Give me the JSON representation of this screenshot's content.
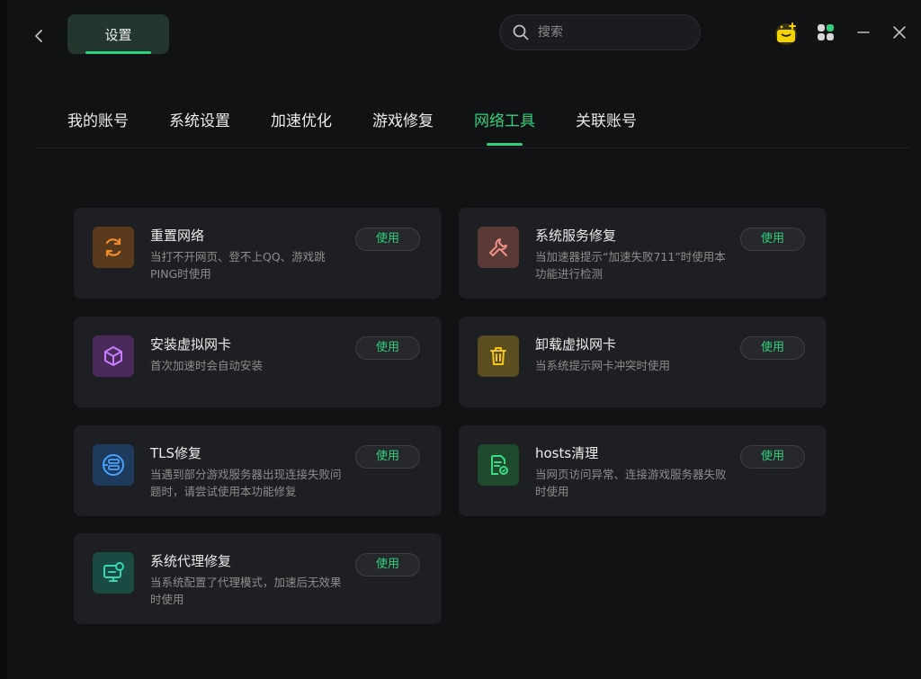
{
  "header": {
    "title": "设置",
    "back_icon": "chevron-left-icon"
  },
  "search": {
    "placeholder": "搜索"
  },
  "toolbar": {
    "gift_icon": "gift-box-icon",
    "apps_icon": "apps-grid-icon",
    "minimize_icon": "minimize-icon",
    "close_icon": "close-icon",
    "gift_color": "#f4d200"
  },
  "tabs": [
    {
      "label": "我的账号"
    },
    {
      "label": "系统设置"
    },
    {
      "label": "加速优化"
    },
    {
      "label": "游戏修复"
    },
    {
      "label": "网络工具",
      "active": true
    },
    {
      "label": "关联账号"
    }
  ],
  "accent": "#2fd17c",
  "tools": [
    {
      "name": "重置网络",
      "desc": "当打不开网页、登不上QQ、游戏跳PING时使用",
      "button": "使用",
      "icon": "refresh-icon",
      "icon_bg": "#5a3a1c",
      "icon_color": "#f08a2c"
    },
    {
      "name": "系统服务修复",
      "desc": "当加速器提示“加速失败711”时使用本功能进行检测",
      "button": "使用",
      "icon": "wrench-icon",
      "icon_bg": "#5a3a36",
      "icon_color": "#f08f86"
    },
    {
      "name": "安装虚拟网卡",
      "desc": "首次加速时会自动安装",
      "button": "使用",
      "icon": "cube-icon",
      "icon_bg": "#4a2a5a",
      "icon_color": "#c77dff"
    },
    {
      "name": "卸载虚拟网卡",
      "desc": "当系统提示网卡冲突时使用",
      "button": "使用",
      "icon": "trash-icon",
      "icon_bg": "#5a4d1f",
      "icon_color": "#f5c518"
    },
    {
      "name": "TLS修复",
      "desc": "当遇到部分游戏服务器出现连接失败问题时，请尝试使用本功能修复",
      "button": "使用",
      "icon": "tls-server-icon",
      "icon_bg": "#1e3a5c",
      "icon_color": "#4aa3ff"
    },
    {
      "name": "hosts清理",
      "desc": "当网页访问异常、连接游戏服务器失败时使用",
      "button": "使用",
      "icon": "file-clean-icon",
      "icon_bg": "#1f4a2e",
      "icon_color": "#3ddc84"
    },
    {
      "name": "系统代理修复",
      "desc": "当系统配置了代理模式，加速后无效果时使用",
      "button": "使用",
      "icon": "monitor-proxy-icon",
      "icon_bg": "#1a4a42",
      "icon_color": "#33d6b5"
    }
  ]
}
